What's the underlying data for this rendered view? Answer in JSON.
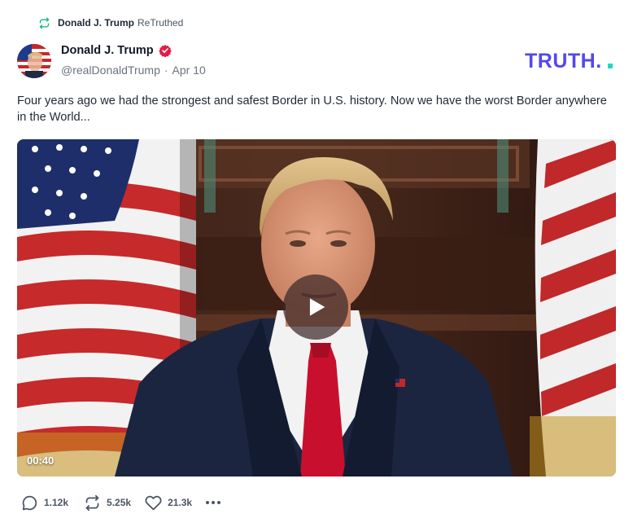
{
  "retruth": {
    "user": "Donald J. Trump",
    "label": "ReTruthed",
    "icon": "retruth-icon"
  },
  "post": {
    "author": "Donald J. Trump",
    "handle": "@realDonaldTrump",
    "separator": "·",
    "date": "Apr 10",
    "verified_icon": "verified-badge-icon",
    "text": "Four years ago we had the strongest and safest Border in U.S. history. Now we have the worst Border anywhere in the World..."
  },
  "brand": {
    "logo_text": "TRUTH.",
    "color": "#5448ee",
    "accent": "#1fd8c5"
  },
  "video": {
    "duration": "00:40",
    "play_icon": "play-icon"
  },
  "actions": {
    "replies": "1.12k",
    "retruths": "5.25k",
    "likes": "21.3k"
  },
  "colors": {
    "verified": "#e11d48",
    "text": "#1f2937",
    "muted": "#6b7280"
  }
}
